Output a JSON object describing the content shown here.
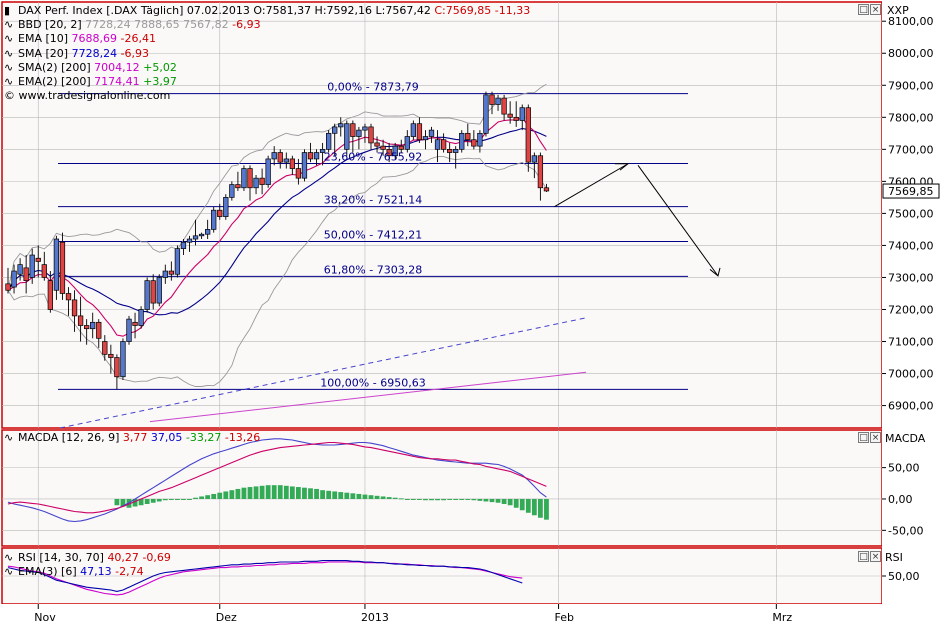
{
  "window": {
    "header_title": "DAX Perf. Index [.DAX Täglich] 07.02.2013",
    "ohlc": "O:7581,37 H:7592,16 L:7567,42",
    "close": "C:7569,85 -11,33",
    "symbol_name": "XXP",
    "last_price": "7569,85",
    "copyright": "© www.tradesignalonline.com"
  },
  "legend": {
    "bbd": {
      "label": "BBD [20, 2]",
      "v1": "7728,24",
      "v2": "7888,65",
      "v3": "7567,82",
      "chg": "-6,93"
    },
    "ema10": {
      "label": "EMA [10]",
      "v": "7688,69",
      "chg": "-26,41"
    },
    "sma20": {
      "label": "SMA [20]",
      "v": "7728,24",
      "chg": "-6,93"
    },
    "sma200": {
      "label": "SMA(2) [200]",
      "v": "7004,12",
      "chg": "+5,02"
    },
    "ema200": {
      "label": "EMA(2) [200]",
      "v": "7174,41",
      "chg": "+3,97"
    }
  },
  "macd_legend": {
    "label": "MACDA [12, 26, 9]",
    "v1": "3,77",
    "v2": "37,05",
    "v3": "-33,27",
    "v4": "-13,26",
    "pane_name": "MACDA"
  },
  "rsi_legend": {
    "rsi": {
      "label": "RSI [14, 30, 70]",
      "v": "40,27",
      "chg": "-0,69"
    },
    "ema": {
      "label": "EMA(3) [6]",
      "v": "47,13",
      "chg": "-2,74"
    },
    "pane_name": "RSI"
  },
  "colors": {
    "up_candle": "#5577cc",
    "down_candle": "#dd4444",
    "bb": "#999999",
    "ema10": "#cc0066",
    "sma20": "#000088",
    "fib": "#000088",
    "frame": "#cc0000",
    "sma200": "#cc44cc",
    "ema200": "#4444cc",
    "macd_hist": "#33aa55",
    "rsi": "#0000aa",
    "rsi_ema": "#cc00cc"
  },
  "chart_data": [
    {
      "type": "candlestick",
      "title": "DAX Perf. Index [.DAX Täglich]",
      "x_axis_labels": [
        {
          "label": "Nov",
          "bar": 5
        },
        {
          "label": "Dez",
          "bar": 35
        },
        {
          "label": "2013",
          "bar": 59
        },
        {
          "label": "Feb",
          "bar": 91
        },
        {
          "label": "Mrz",
          "bar": 127
        }
      ],
      "y_axis_ticks": [
        "8100,00",
        "8000,00",
        "7900,00",
        "7800,00",
        "7700,00",
        "7600,00",
        "7500,00",
        "7400,00",
        "7300,00",
        "7200,00",
        "7100,00",
        "7000,00",
        "6900,00"
      ],
      "y_tick_values": [
        8100,
        8000,
        7900,
        7800,
        7700,
        7600,
        7500,
        7400,
        7300,
        7200,
        7100,
        7000,
        6900
      ],
      "ylim": [
        6830,
        8160
      ],
      "ohlc": [
        [
          7280,
          7330,
          7250,
          7260
        ],
        [
          7270,
          7340,
          7250,
          7320
        ],
        [
          7310,
          7360,
          7290,
          7340
        ],
        [
          7330,
          7370,
          7250,
          7290
        ],
        [
          7300,
          7390,
          7280,
          7370
        ],
        [
          7360,
          7400,
          7300,
          7350
        ],
        [
          7340,
          7380,
          7290,
          7300
        ],
        [
          7290,
          7320,
          7190,
          7200
        ],
        [
          7260,
          7430,
          7230,
          7420
        ],
        [
          7410,
          7440,
          7230,
          7250
        ],
        [
          7250,
          7270,
          7180,
          7230
        ],
        [
          7230,
          7260,
          7130,
          7180
        ],
        [
          7180,
          7240,
          7100,
          7150
        ],
        [
          7150,
          7170,
          7090,
          7140
        ],
        [
          7140,
          7190,
          7110,
          7160
        ],
        [
          7160,
          7170,
          7080,
          7110
        ],
        [
          7100,
          7120,
          7040,
          7060
        ],
        [
          7060,
          7090,
          7000,
          7050
        ],
        [
          7050,
          7060,
          6950,
          6990
        ],
        [
          6990,
          7110,
          6980,
          7100
        ],
        [
          7100,
          7180,
          7090,
          7170
        ],
        [
          7160,
          7190,
          7110,
          7150
        ],
        [
          7150,
          7210,
          7140,
          7200
        ],
        [
          7200,
          7300,
          7190,
          7290
        ],
        [
          7290,
          7310,
          7200,
          7220
        ],
        [
          7220,
          7310,
          7210,
          7300
        ],
        [
          7300,
          7340,
          7280,
          7320
        ],
        [
          7320,
          7350,
          7290,
          7310
        ],
        [
          7310,
          7400,
          7300,
          7390
        ],
        [
          7390,
          7420,
          7370,
          7410
        ],
        [
          7410,
          7430,
          7380,
          7420
        ],
        [
          7420,
          7480,
          7400,
          7430
        ],
        [
          7430,
          7440,
          7420,
          7435
        ],
        [
          7435,
          7480,
          7420,
          7450
        ],
        [
          7450,
          7520,
          7440,
          7510
        ],
        [
          7510,
          7530,
          7480,
          7490
        ],
        [
          7490,
          7560,
          7480,
          7550
        ],
        [
          7550,
          7600,
          7540,
          7590
        ],
        [
          7590,
          7630,
          7570,
          7580
        ],
        [
          7580,
          7650,
          7570,
          7640
        ],
        [
          7640,
          7650,
          7540,
          7580
        ],
        [
          7580,
          7620,
          7560,
          7610
        ],
        [
          7610,
          7640,
          7560,
          7590
        ],
        [
          7590,
          7680,
          7580,
          7670
        ],
        [
          7670,
          7710,
          7650,
          7690
        ],
        [
          7690,
          7700,
          7640,
          7660
        ],
        [
          7660,
          7690,
          7640,
          7670
        ],
        [
          7670,
          7680,
          7620,
          7640
        ],
        [
          7640,
          7670,
          7590,
          7610
        ],
        [
          7610,
          7700,
          7600,
          7690
        ],
        [
          7690,
          7720,
          7660,
          7670
        ],
        [
          7670,
          7700,
          7650,
          7690
        ],
        [
          7690,
          7720,
          7650,
          7700
        ],
        [
          7700,
          7760,
          7690,
          7750
        ],
        [
          7750,
          7780,
          7680,
          7770
        ],
        [
          7770,
          7800,
          7740,
          7780
        ],
        [
          7700,
          7790,
          7680,
          7780
        ],
        [
          7780,
          7790,
          7690,
          7740
        ],
        [
          7740,
          7770,
          7700,
          7760
        ],
        [
          7760,
          7780,
          7720,
          7770
        ],
        [
          7770,
          7780,
          7700,
          7720
        ],
        [
          7720,
          7740,
          7690,
          7710
        ],
        [
          7710,
          7730,
          7680,
          7700
        ],
        [
          7700,
          7720,
          7660,
          7680
        ],
        [
          7680,
          7720,
          7670,
          7710
        ],
        [
          7710,
          7730,
          7690,
          7700
        ],
        [
          7700,
          7760,
          7690,
          7740
        ],
        [
          7740,
          7790,
          7730,
          7780
        ],
        [
          7780,
          7800,
          7720,
          7730
        ],
        [
          7730,
          7760,
          7700,
          7740
        ],
        [
          7740,
          7770,
          7720,
          7760
        ],
        [
          7700,
          7760,
          7660,
          7730
        ],
        [
          7730,
          7750,
          7690,
          7700
        ],
        [
          7700,
          7720,
          7660,
          7690
        ],
        [
          7690,
          7710,
          7640,
          7700
        ],
        [
          7700,
          7760,
          7690,
          7750
        ],
        [
          7750,
          7780,
          7710,
          7730
        ],
        [
          7730,
          7760,
          7700,
          7710
        ],
        [
          7710,
          7760,
          7690,
          7750
        ],
        [
          7750,
          7880,
          7740,
          7870
        ],
        [
          7870,
          7880,
          7810,
          7840
        ],
        [
          7840,
          7870,
          7820,
          7860
        ],
        [
          7860,
          7870,
          7790,
          7810
        ],
        [
          7810,
          7850,
          7780,
          7800
        ],
        [
          7800,
          7850,
          7770,
          7790
        ],
        [
          7790,
          7840,
          7760,
          7830
        ],
        [
          7830,
          7840,
          7630,
          7660
        ],
        [
          7660,
          7690,
          7610,
          7680
        ],
        [
          7680,
          7690,
          7540,
          7580
        ],
        [
          7580,
          7592,
          7567,
          7570
        ]
      ],
      "fibonacci_levels": [
        {
          "label": "0,00% - 7873,79",
          "value": 7873.79
        },
        {
          "label": "23,60% - 7655,92",
          "value": 7655.92
        },
        {
          "label": "38,20% - 7521,14",
          "value": 7521.14
        },
        {
          "label": "50,00% - 7412,21",
          "value": 7412.21
        },
        {
          "label": "61,80% - 7303,28",
          "value": 7303.28
        },
        {
          "label": "100,00% - 6950,63",
          "value": 6950.63
        }
      ]
    },
    {
      "type": "line",
      "title": "MACDA [12, 26, 9]",
      "y_axis_ticks": [
        "50,00",
        "0,00",
        "-50,00"
      ],
      "y_tick_values": [
        50,
        0,
        -50
      ],
      "ylim": [
        -75,
        110
      ],
      "macd": [
        -8,
        -6,
        -5,
        -6,
        -7,
        -8,
        -10,
        -12,
        -14,
        -16,
        -18,
        -20,
        -21,
        -22,
        -22,
        -21,
        -19,
        -17,
        -15,
        -12,
        -8,
        -4,
        0,
        4,
        8,
        12,
        15,
        18,
        22,
        26,
        30,
        34,
        38,
        42,
        46,
        50,
        54,
        58,
        62,
        66,
        70,
        73,
        76,
        78,
        80,
        82,
        83,
        84,
        85,
        86,
        87,
        88,
        89,
        90,
        90,
        89,
        88,
        87,
        85,
        83,
        82,
        80,
        78,
        76,
        74,
        72,
        70,
        68,
        66,
        65,
        64,
        64,
        63,
        62,
        62,
        60,
        58,
        56,
        55,
        52,
        50,
        48,
        46,
        44,
        40,
        36,
        32,
        28,
        24,
        20
      ],
      "signal": [
        -5,
        -8,
        -10,
        -12,
        -14,
        -17,
        -20,
        -24,
        -28,
        -32,
        -35,
        -36,
        -35,
        -33,
        -30,
        -27,
        -24,
        -20,
        -16,
        -11,
        -6,
        0,
        6,
        12,
        18,
        24,
        30,
        36,
        42,
        48,
        54,
        59,
        64,
        68,
        72,
        75,
        78,
        81,
        84,
        87,
        90,
        92,
        94,
        95,
        96,
        96,
        95,
        94,
        92,
        90,
        88,
        87,
        86,
        86,
        86,
        87,
        88,
        89,
        90,
        90,
        89,
        87,
        85,
        82,
        79,
        76,
        73,
        70,
        68,
        66,
        64,
        62,
        61,
        60,
        59,
        58,
        57,
        57,
        57,
        57,
        56,
        55,
        52,
        48,
        43,
        38,
        30,
        20,
        10,
        3
      ],
      "histogram": [
        -10,
        -12,
        -14,
        -12,
        -10,
        -8,
        -6,
        -4,
        -2,
        0,
        0,
        0,
        0,
        2,
        4,
        6,
        8,
        10,
        12,
        14,
        16,
        18,
        19,
        20,
        21,
        22,
        22,
        22,
        21,
        20,
        19,
        18,
        17,
        16,
        14,
        13,
        12,
        11,
        10,
        9,
        8,
        7,
        6,
        5,
        4,
        3,
        2,
        1,
        0,
        0,
        -1,
        -2,
        -2,
        -2,
        -2,
        -1,
        0,
        0,
        -1,
        -2,
        -3,
        -4,
        -5,
        -6,
        -8,
        -10,
        -14,
        -18,
        -22,
        -26,
        -30,
        -33
      ]
    },
    {
      "type": "line",
      "title": "RSI [14, 30, 70]",
      "y_axis_ticks": [
        "50,00"
      ],
      "y_tick_values": [
        50
      ],
      "ylim": [
        10,
        90
      ],
      "rsi": [
        62,
        60,
        58,
        57,
        56,
        55,
        52,
        48,
        44,
        42,
        40,
        38,
        36,
        34,
        33,
        32,
        31,
        30,
        28,
        30,
        34,
        38,
        42,
        46,
        50,
        53,
        55,
        56,
        57,
        58,
        59,
        60,
        61,
        62,
        63,
        64,
        65,
        66,
        66,
        67,
        67,
        68,
        68,
        69,
        69,
        70,
        70,
        70,
        70,
        71,
        71,
        71,
        72,
        72,
        72,
        72,
        72,
        71,
        71,
        70,
        70,
        69,
        69,
        68,
        67,
        67,
        66,
        66,
        65,
        65,
        64,
        64,
        64,
        63,
        63,
        62,
        62,
        61,
        60,
        58,
        55,
        52,
        49,
        46,
        43,
        40
      ],
      "rsi_ema": [
        64,
        63,
        61,
        59,
        57,
        56,
        54,
        50,
        46,
        43,
        40,
        37,
        34,
        31,
        29,
        27,
        25,
        24,
        23,
        24,
        27,
        31,
        35,
        39,
        43,
        47,
        50,
        52,
        54,
        56,
        57,
        58,
        59,
        60,
        61,
        62,
        62,
        63,
        63,
        64,
        64,
        65,
        65,
        66,
        66,
        67,
        67,
        68,
        68,
        68,
        69,
        69,
        69,
        70,
        70,
        70,
        70,
        70,
        70,
        69,
        69,
        69,
        69,
        68,
        68,
        67,
        67,
        66,
        66,
        65,
        65,
        64,
        64,
        63,
        62,
        62,
        61,
        60,
        59,
        57,
        55,
        53,
        51,
        49,
        48,
        47
      ]
    }
  ],
  "pane_labels": {
    "macd_pane": "MACDA",
    "rsi_pane": "RSI"
  }
}
